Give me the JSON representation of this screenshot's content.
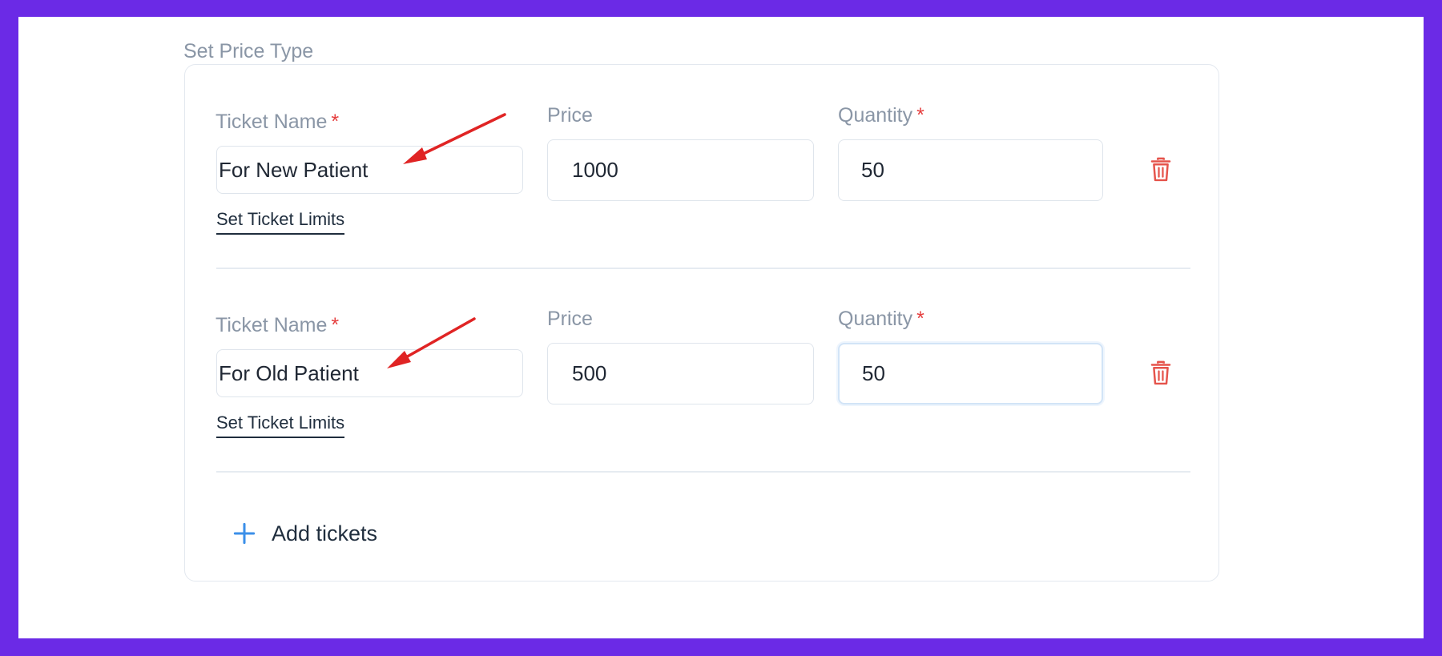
{
  "section": {
    "title": "Set Price Type"
  },
  "tickets": [
    {
      "name_label": "Ticket Name",
      "name_value": "For New Patient",
      "price_label": "Price",
      "price_value": "1000",
      "quantity_label": "Quantity",
      "quantity_value": "50",
      "required_mark": "*",
      "limits_link": "Set Ticket Limits"
    },
    {
      "name_label": "Ticket Name",
      "name_value": "For Old Patient",
      "price_label": "Price",
      "price_value": "500",
      "quantity_label": "Quantity",
      "quantity_value": "50",
      "required_mark": "*",
      "limits_link": "Set Ticket Limits"
    }
  ],
  "add_button": {
    "label": "Add tickets"
  },
  "icons": {
    "delete": "trash-icon",
    "add": "plus-icon",
    "annotation": "red-arrow"
  },
  "colors": {
    "background": "#6b2ae6",
    "required": "#e53e3e",
    "delete_icon": "#e5534b",
    "add_icon": "#3b8fe8",
    "annotation_arrow": "#e02424"
  }
}
